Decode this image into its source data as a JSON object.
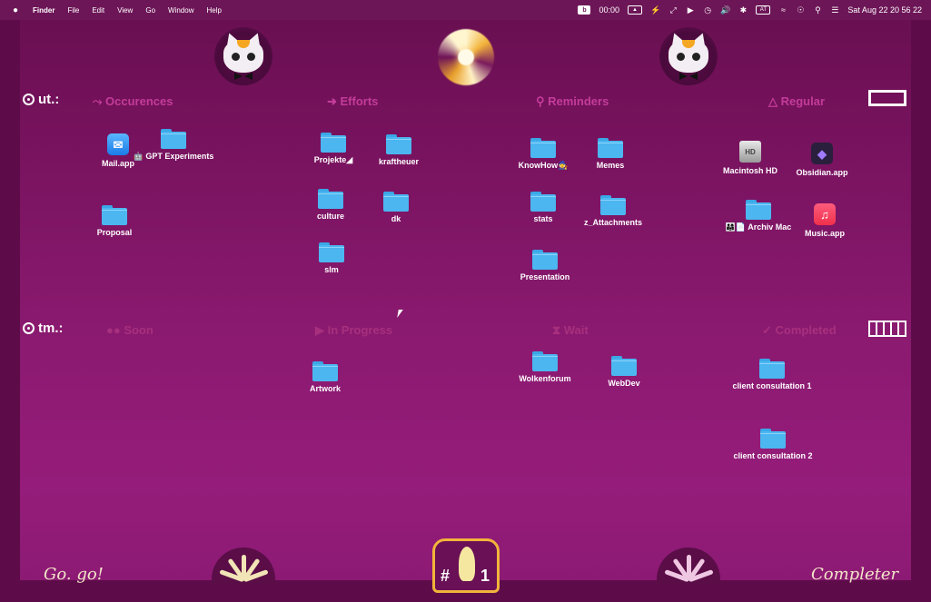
{
  "menubar": {
    "apple": "",
    "app": "Finder",
    "menus": [
      "File",
      "Edit",
      "View",
      "Go",
      "Window",
      "Help"
    ],
    "timer": "00:00",
    "input_source": "AT",
    "datetime": "Sat Aug 22  20 56 22"
  },
  "sections": {
    "ut": "ut.:",
    "tm": "tm.:"
  },
  "headers_top": {
    "occurences": "⤳ Occurences",
    "efforts": "➜ Efforts",
    "reminders": "⚲ Reminders",
    "regular": "△ Regular"
  },
  "headers_bottom": {
    "soon": "●● Soon",
    "in_progress": "▶ In Progress",
    "wait": "⧗ Wait",
    "completed": "✓ Completed"
  },
  "icons": {
    "mail": "Mail.app",
    "gpt": "🤖 GPT Experiments",
    "proposal": "Proposal",
    "projekte": "Projekte◢",
    "kraftheuer": "kraftheuer",
    "culture": "culture",
    "dk": "dk",
    "slm": "slm",
    "knowhow": "KnowHow🧙",
    "memes": "Memes",
    "stats": "stats",
    "z_attachments": "z_Attachments",
    "presentation": "Presentation",
    "macintosh_hd": "Macintosh HD",
    "obsidian": "Obsidian.app",
    "archiv_mac": "👨‍👩‍👧📄 Archiv Mac",
    "music": "Music.app",
    "artwork": "Artwork",
    "wolkenforum": "Wolkenforum",
    "webdev": "WebDev",
    "client1": "client consultation 1",
    "client2": "client consultation 2"
  },
  "bottom": {
    "left_script": "Go. go!",
    "right_script": "Completer",
    "badge_hash": "#",
    "badge_one": "1"
  }
}
